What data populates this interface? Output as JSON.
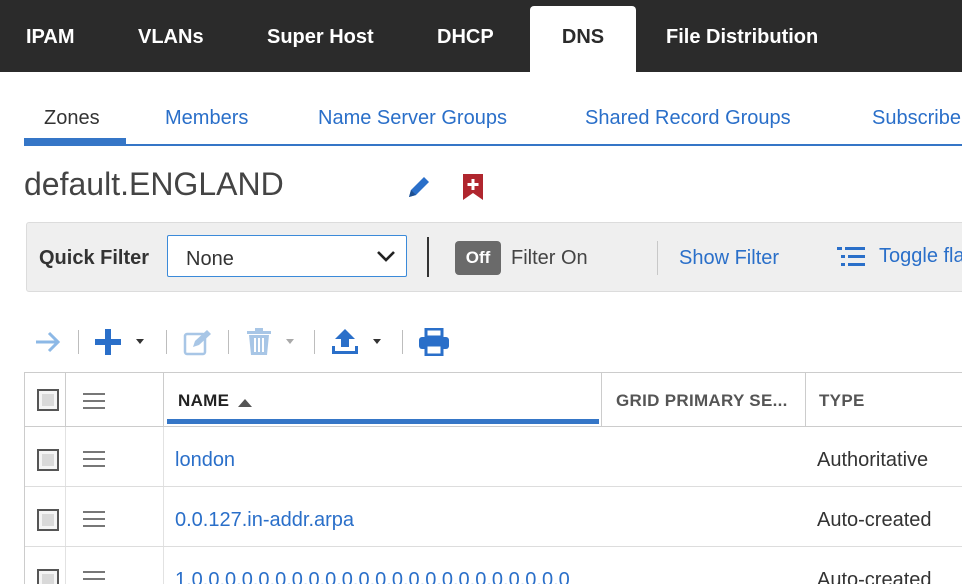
{
  "top_nav": {
    "tabs": [
      {
        "label": "IPAM"
      },
      {
        "label": "VLANs"
      },
      {
        "label": "Super Host"
      },
      {
        "label": "DHCP"
      },
      {
        "label": "DNS",
        "active": true
      },
      {
        "label": "File Distribution"
      }
    ]
  },
  "sub_nav": {
    "tabs": [
      {
        "label": "Zones",
        "active": true
      },
      {
        "label": "Members"
      },
      {
        "label": "Name Server Groups"
      },
      {
        "label": "Shared Record Groups"
      },
      {
        "label": "Subscribe"
      }
    ]
  },
  "page": {
    "title": "default.ENGLAND",
    "edit_icon": "pencil-icon",
    "bookmark_icon": "bookmark-plus-icon"
  },
  "filter_bar": {
    "quick_filter_label": "Quick Filter",
    "quick_filter_value": "None",
    "toggle_state": "Off",
    "filter_on_label": "Filter On",
    "show_filter": "Show Filter",
    "toggle_flat": "Toggle fla"
  },
  "toolbar": {
    "icons": [
      "arrow-right-icon",
      "plus-icon",
      "edit-icon",
      "trash-icon",
      "upload-icon",
      "print-icon"
    ]
  },
  "grid": {
    "columns": [
      "NAME",
      "GRID PRIMARY SE...",
      "TYPE"
    ],
    "sort": {
      "column": "NAME",
      "direction": "ascending"
    },
    "rows": [
      {
        "name": "london",
        "grid_primary": "",
        "type": "Authoritative"
      },
      {
        "name": "0.0.127.in-addr.arpa",
        "grid_primary": "",
        "type": "Auto-created"
      },
      {
        "name": "1.0.0.0.0.0.0.0.0.0.0.0.0.0.0.0.0.0.0.0.0.0.0.0",
        "grid_primary": "",
        "type": "Auto-created"
      }
    ]
  },
  "colors": {
    "nav_bg": "#2b2b2b",
    "link": "#2a6fc9",
    "accent": "#3576c7",
    "bookmark": "#b0262e"
  }
}
